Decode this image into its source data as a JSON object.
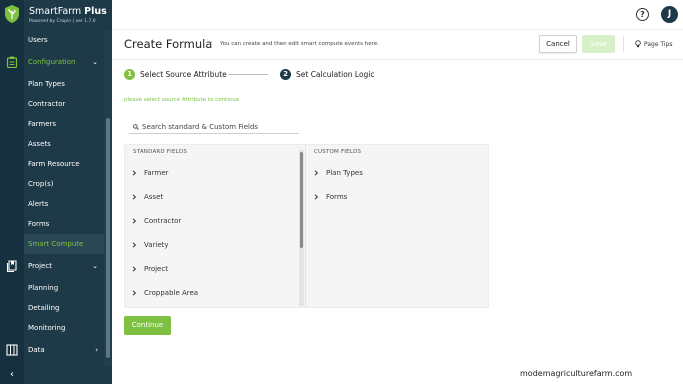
{
  "brand": {
    "name_light": "SmartFarm ",
    "name_bold": "Plus",
    "subtitle": "Powered by Cropin  |  ver 1.7.0"
  },
  "sidebar": {
    "items": [
      {
        "label": "Users"
      },
      {
        "label": "Configuration"
      },
      {
        "label": "Plan Types"
      },
      {
        "label": "Contractor"
      },
      {
        "label": "Farmers"
      },
      {
        "label": "Assets"
      },
      {
        "label": "Farm Resource"
      },
      {
        "label": "Crop(s)"
      },
      {
        "label": "Alerts"
      },
      {
        "label": "Forms"
      },
      {
        "label": "Smart Compute"
      },
      {
        "label": "Project"
      },
      {
        "label": "Planning"
      },
      {
        "label": "Detailing"
      },
      {
        "label": "Monitoring"
      },
      {
        "label": "Data"
      }
    ],
    "collapse_glyph": "‹"
  },
  "topbar": {
    "help_glyph": "?",
    "avatar_initial": "J"
  },
  "header": {
    "title": "Create Formula",
    "description": "You can create and then edit smart compute events here.",
    "cancel_label": "Cancel",
    "save_label": "Save",
    "tips_label": "Page Tips"
  },
  "steps": [
    {
      "number": "1",
      "label": "Select Source Attribute"
    },
    {
      "number": "2",
      "label": "Set Calculation Logic"
    }
  ],
  "hint": "please select source Attribute to continue",
  "search": {
    "placeholder": "Search standard & Custom Fields",
    "value": ""
  },
  "standard_fields": {
    "heading": "STANDARD FIELDS",
    "items": [
      "Farmer",
      "Asset",
      "Contractor",
      "Variety",
      "Project",
      "Croppable Area"
    ]
  },
  "custom_fields": {
    "heading": "CUSTOM FIELDS",
    "items": [
      "Plan Types",
      "Forms"
    ]
  },
  "continue_label": "Continue",
  "watermark": "modemagriculturefarm.com",
  "colors": {
    "sidebar": "#1e3a48",
    "accent": "#7ec142",
    "save_disabled": "#d8f0c8"
  }
}
